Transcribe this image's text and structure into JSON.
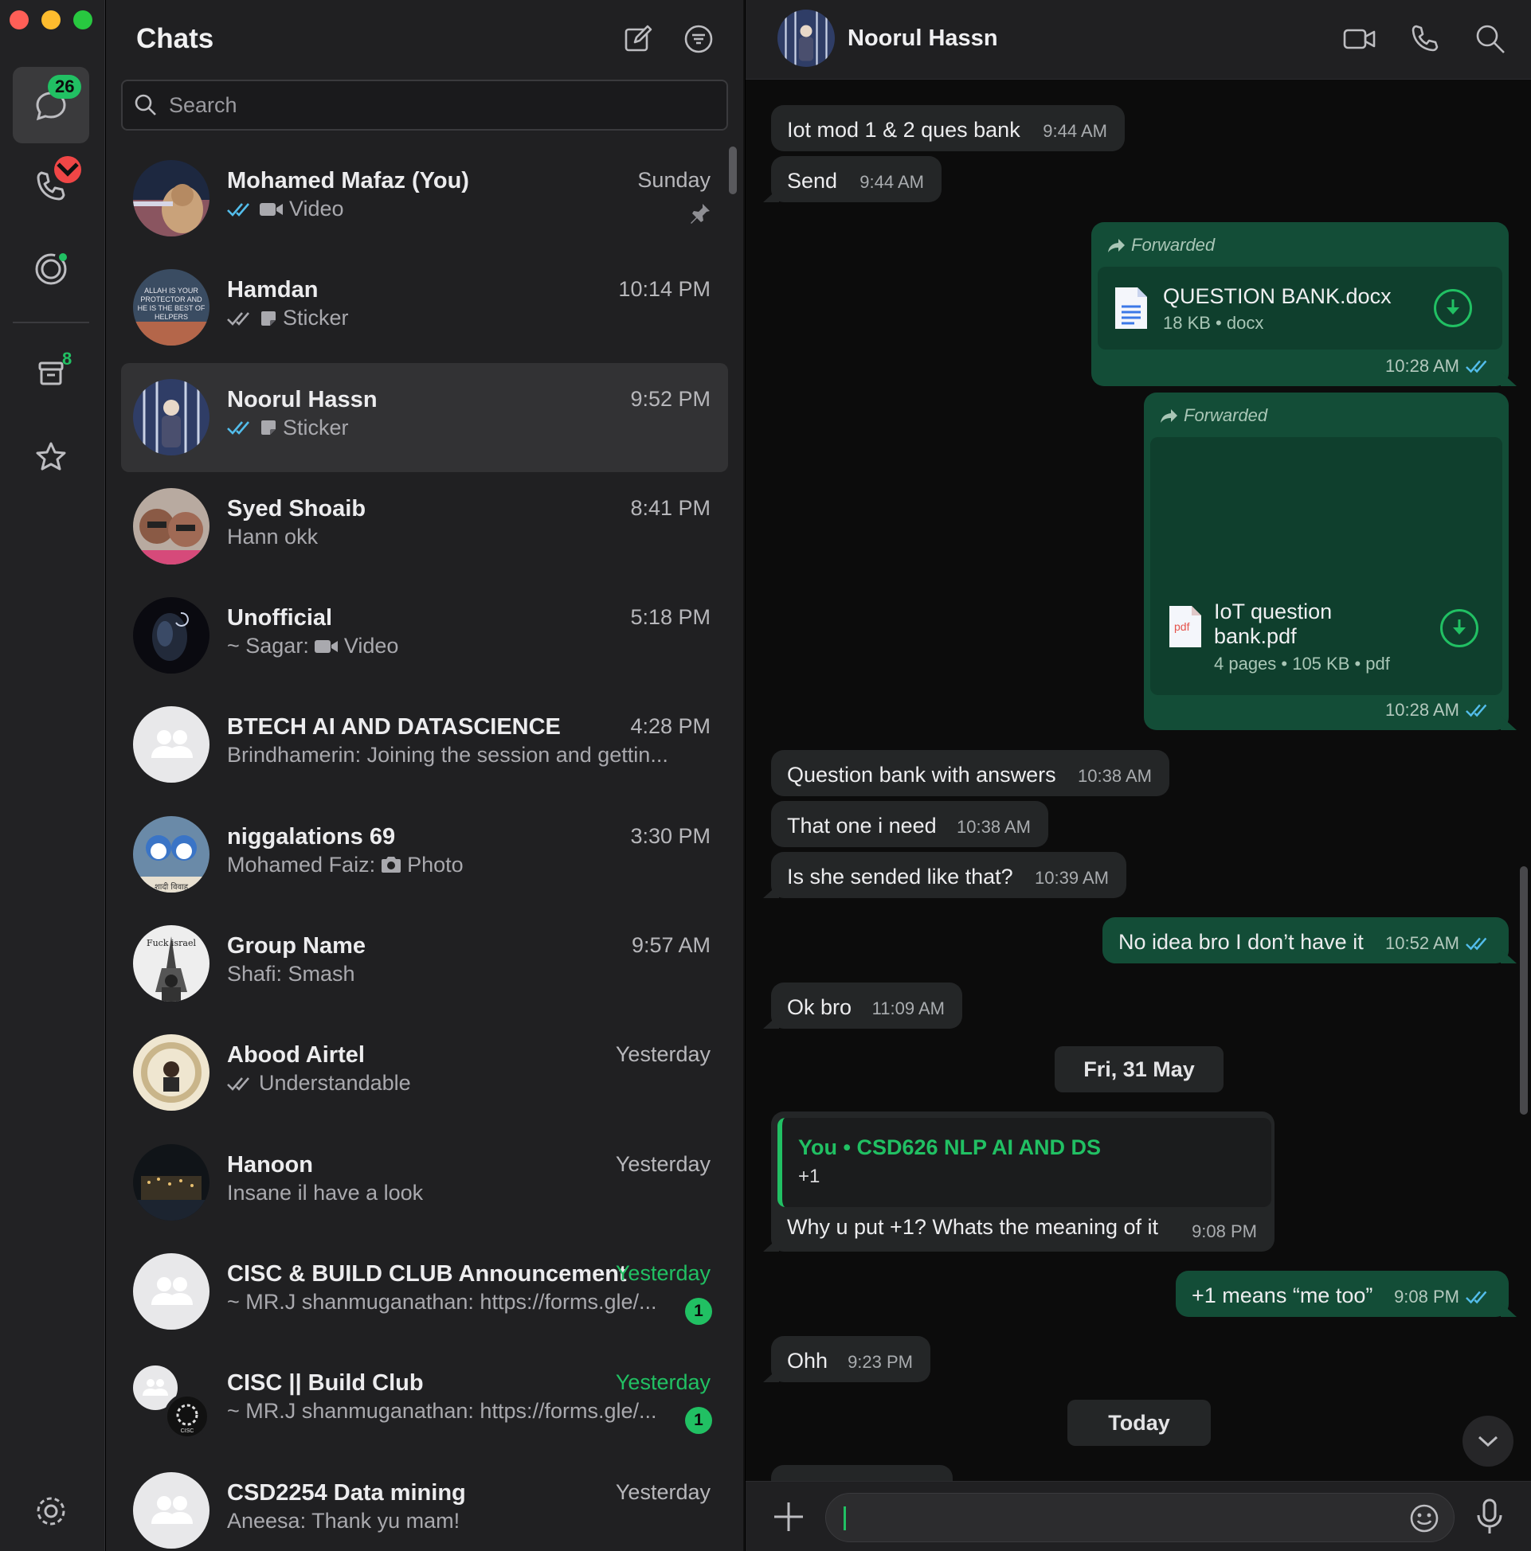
{
  "rail": {
    "chats_badge": "26",
    "archive_badge": "8"
  },
  "list": {
    "title": "Chats",
    "search_placeholder": "Search",
    "chats": [
      {
        "name": "Mohamed Mafaz (You)",
        "time": "Sunday",
        "preview": "Video",
        "ticks": "blue",
        "media": "video-icon",
        "pinned": true
      },
      {
        "name": "Hamdan",
        "time": "10:14 PM",
        "preview": "Sticker",
        "ticks": "grey",
        "media": "sticker-icon"
      },
      {
        "name": "Noorul Hassn",
        "time": "9:52 PM",
        "preview": "Sticker",
        "ticks": "blue",
        "media": "sticker-icon",
        "selected": true
      },
      {
        "name": "Syed Shoaib",
        "time": "8:41 PM",
        "preview": "Hann okk"
      },
      {
        "name": "Unofficial",
        "time": "5:18 PM",
        "sender": "~ Sagar:",
        "preview": "Video",
        "media": "video-icon"
      },
      {
        "name": "BTECH AI AND DATASCIENCE",
        "time": "4:28 PM",
        "preview": "Brindhamerin: Joining the session and gettin..."
      },
      {
        "name": "niggalations 69",
        "time": "3:30 PM",
        "sender": "Mohamed Faiz:",
        "preview": "Photo",
        "media": "camera-icon"
      },
      {
        "name": "Group Name",
        "time": "9:57 AM",
        "preview": "Shafi: Smash"
      },
      {
        "name": "Abood Airtel",
        "time": "Yesterday",
        "preview": "Understandable",
        "ticks": "grey"
      },
      {
        "name": "Hanoon",
        "time": "Yesterday",
        "preview": "Insane il have a look"
      },
      {
        "name": "CISC & BUILD CLUB Announcement",
        "time": "Yesterday",
        "preview": "~ MR.J shanmuganathan: https://forms.gle/...",
        "unread": "1"
      },
      {
        "name": "CISC || Build  Club",
        "time": "Yesterday",
        "preview": "~ MR.J shanmuganathan: https://forms.gle/...",
        "unread": "1"
      },
      {
        "name": "CSD2254 Data mining",
        "time": "Yesterday",
        "preview": "Aneesa: Thank yu mam!"
      }
    ]
  },
  "conversation": {
    "contact_name": "Noorul Hassn",
    "messages": [
      {
        "text": "Iot mod 1 & 2 ques bank",
        "time": "9:44 AM"
      },
      {
        "text": "Send",
        "time": "9:44 AM"
      },
      {
        "forwarded_label": "Forwarded",
        "file_name": "QUESTION BANK.docx",
        "file_meta": "18 KB • docx",
        "time": "10:28 AM"
      },
      {
        "forwarded_label": "Forwarded",
        "file_name_line1": "IoT question",
        "file_name_line2": "bank.pdf",
        "file_meta": "4 pages • 105 KB • pdf",
        "file_type": "pdf",
        "time": "10:28 AM"
      },
      {
        "text": "Question bank with answers",
        "time": "10:38 AM"
      },
      {
        "text": "That one i need",
        "time": "10:38 AM"
      },
      {
        "text": "Is she sended like that?",
        "time": "10:39 AM"
      },
      {
        "text": "No idea bro I don’t have it",
        "time": "10:52 AM"
      },
      {
        "text": "Ok bro",
        "time": "11:09 AM"
      },
      {
        "quote_author": "You • CSD626 NLP AI AND DS",
        "quote_text": "+1",
        "text": "Why u put +1? Whats the meaning of it",
        "time": "9:08 PM"
      },
      {
        "text": "+1 means “me too”",
        "time": "9:08 PM"
      },
      {
        "text": "Ohh",
        "time": "9:23 PM"
      }
    ],
    "day_separators": [
      "Fri, 31 May",
      "Today"
    ]
  },
  "colors": {
    "accent_green": "#21c063",
    "outgoing_bubble": "#134d37",
    "incoming_bubble": "#242627",
    "read_tick_blue": "#53bdeb"
  }
}
